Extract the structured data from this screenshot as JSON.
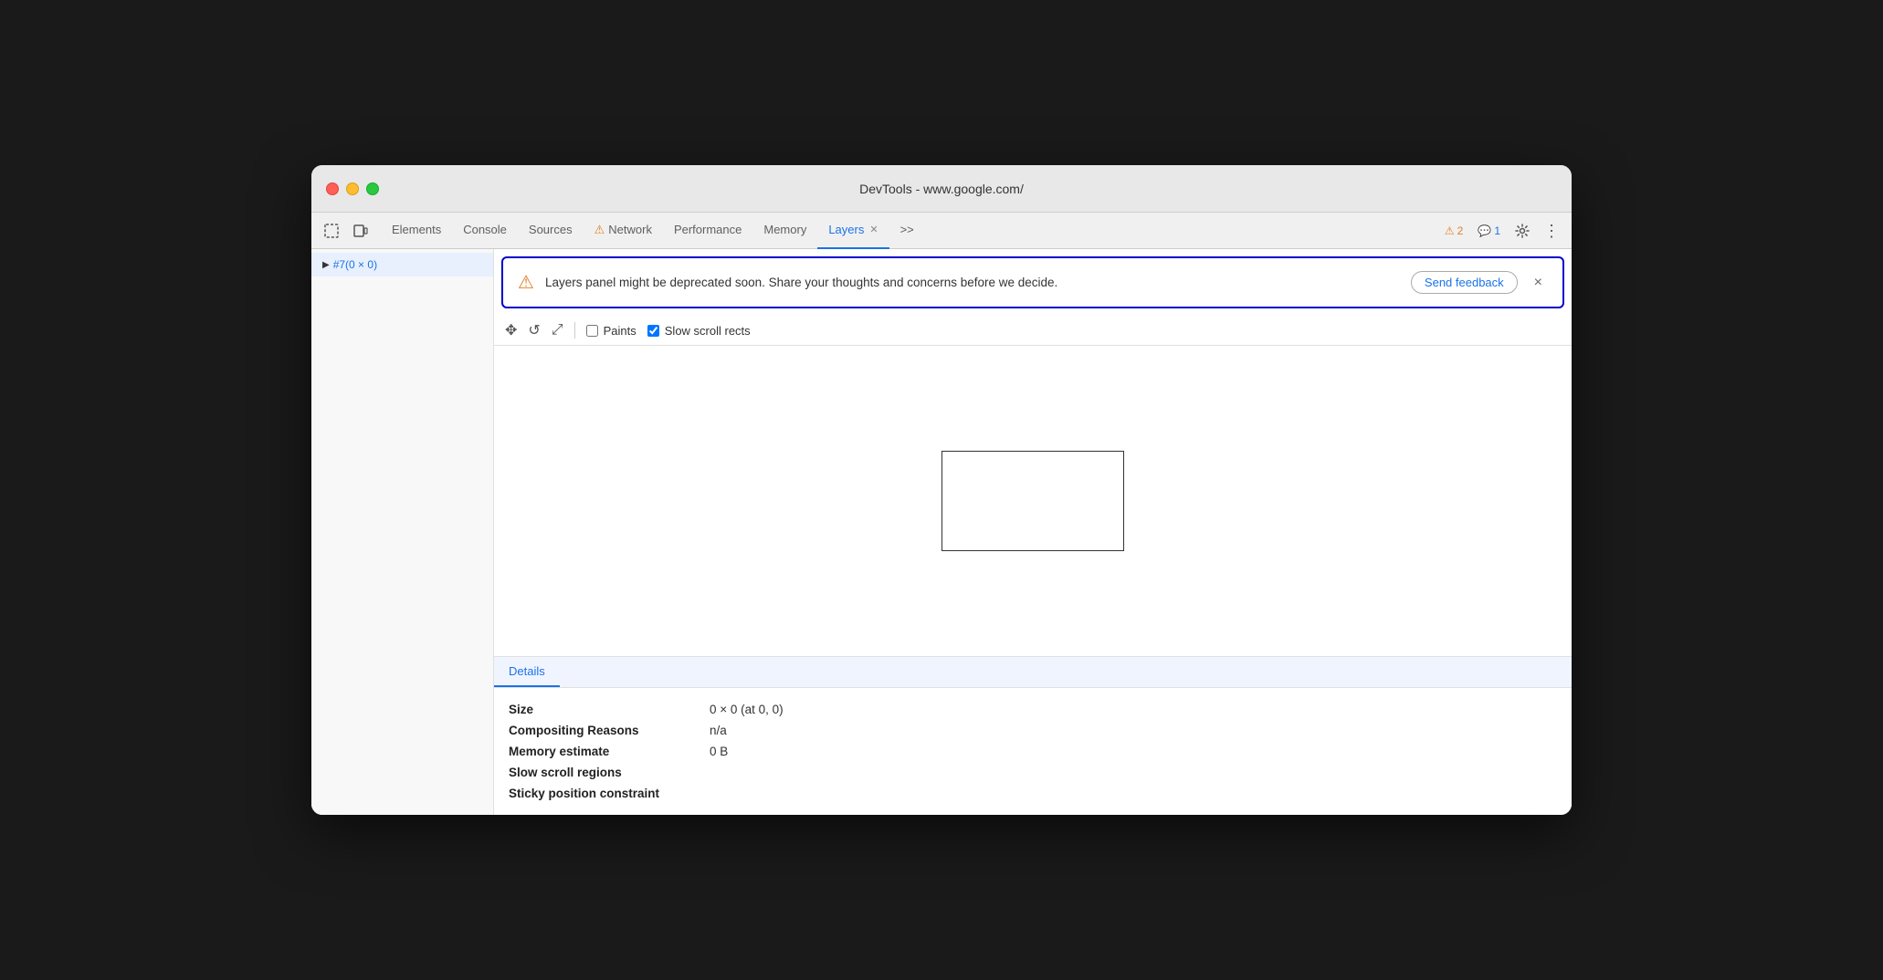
{
  "window": {
    "title": "DevTools - www.google.com/"
  },
  "tabs": {
    "items": [
      {
        "id": "elements",
        "label": "Elements",
        "active": false,
        "warning": false,
        "closable": false
      },
      {
        "id": "console",
        "label": "Console",
        "active": false,
        "warning": false,
        "closable": false
      },
      {
        "id": "sources",
        "label": "Sources",
        "active": false,
        "warning": false,
        "closable": false
      },
      {
        "id": "network",
        "label": "Network",
        "active": false,
        "warning": true,
        "closable": false
      },
      {
        "id": "performance",
        "label": "Performance",
        "active": false,
        "warning": false,
        "closable": false
      },
      {
        "id": "memory",
        "label": "Memory",
        "active": false,
        "warning": false,
        "closable": false
      },
      {
        "id": "layers",
        "label": "Layers",
        "active": true,
        "warning": false,
        "closable": true
      }
    ],
    "overflow_label": ">>",
    "warning_count": "2",
    "message_count": "1"
  },
  "sidebar": {
    "items": [
      {
        "id": "layer1",
        "label": "#7(0 × 0)",
        "selected": true,
        "arrow": "▶"
      }
    ]
  },
  "banner": {
    "text": "Layers panel might be deprecated soon. Share your thoughts and concerns before we decide.",
    "send_feedback_label": "Send feedback",
    "close_label": "×"
  },
  "toolbar": {
    "paints_label": "Paints",
    "slow_scroll_label": "Slow scroll rects",
    "paints_checked": false,
    "slow_scroll_checked": true
  },
  "details": {
    "tab_label": "Details",
    "rows": [
      {
        "label": "Size",
        "value": "0 × 0 (at 0, 0)"
      },
      {
        "label": "Compositing Reasons",
        "value": "n/a"
      },
      {
        "label": "Memory estimate",
        "value": "0 B"
      },
      {
        "label": "Slow scroll regions",
        "value": ""
      },
      {
        "label": "Sticky position constraint",
        "value": ""
      }
    ]
  },
  "icons": {
    "selector": "⬚",
    "device": "▭",
    "move": "✥",
    "rotate": "↺",
    "resize": "⤢"
  }
}
